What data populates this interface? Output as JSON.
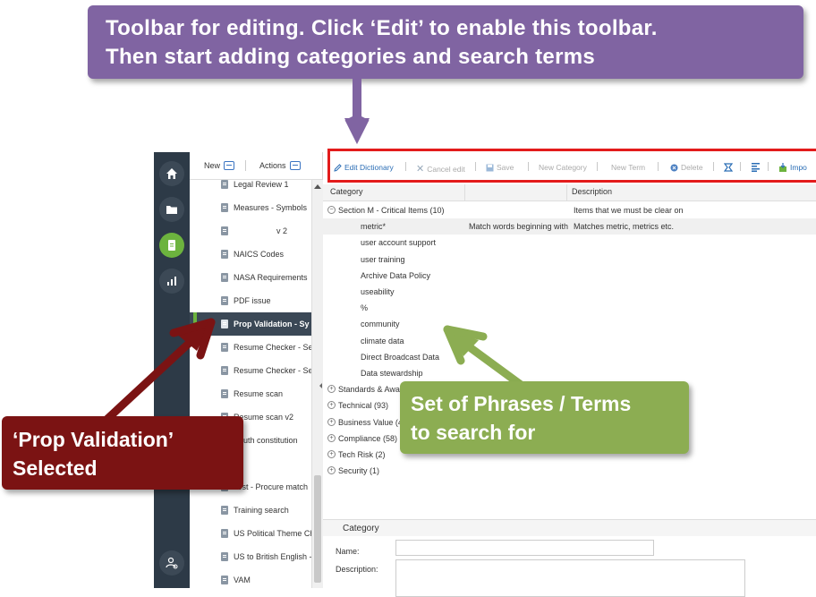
{
  "callouts": {
    "top": {
      "line1": "Toolbar for editing. Click ‘Edit’ to enable this toolbar.",
      "line2": "Then start adding categories and search terms"
    },
    "green": {
      "line1": "Set of Phrases / Terms",
      "line2": "to search for"
    },
    "red": {
      "line1": "‘Prop Validation’",
      "line2": "Selected"
    }
  },
  "colors": {
    "callout_purple": "#8064a2",
    "callout_green": "#8cad52",
    "callout_red": "#7b1313",
    "highlight_red": "#e31b1b",
    "nav_bg": "#2d3a47",
    "nav_active": "#6cb33e"
  },
  "nav": {
    "icons": [
      "home-icon",
      "folder-icon",
      "dictionary-icon",
      "chart-icon",
      "settings-user-icon"
    ]
  },
  "list_pane": {
    "new_label": "New",
    "actions_label": "Actions",
    "items": [
      {
        "label": "Legal Review 1"
      },
      {
        "label": "Measures - Symbols"
      },
      {
        "label": "v 2"
      },
      {
        "label": "NAICS Codes"
      },
      {
        "label": "NASA Requirements"
      },
      {
        "label": "PDF issue"
      },
      {
        "label": "Prop Validation - Sy",
        "selected": true
      },
      {
        "label": "Resume Checker - Sec"
      },
      {
        "label": "Resume Checker - Sec"
      },
      {
        "label": "Resume scan"
      },
      {
        "label": "Resume scan v2"
      },
      {
        "label": "South constitution"
      },
      {
        "label": ""
      },
      {
        "label": "Test - Procure match"
      },
      {
        "label": "Training search"
      },
      {
        "label": "US Political Theme Ch"
      },
      {
        "label": "US to British English -"
      },
      {
        "label": "VAM"
      }
    ]
  },
  "toolbar": {
    "edit_dictionary": "Edit Dictionary",
    "cancel_edit": "Cancel edit",
    "save": "Save",
    "new_category": "New Category",
    "new_term": "New Term",
    "delete": "Delete",
    "import": "Impo"
  },
  "grid": {
    "columns": [
      "Category",
      "Description"
    ],
    "rows": [
      {
        "kind": "group",
        "expanded": true,
        "label": "Section M - Critical Items (10)",
        "description": "Items that we must be clear on"
      },
      {
        "kind": "term",
        "label": "metric*",
        "match": "Match words beginning with",
        "description": "Matches metric, metrics etc.",
        "highlight": true
      },
      {
        "kind": "term",
        "label": "user account support"
      },
      {
        "kind": "term",
        "label": "user training"
      },
      {
        "kind": "term",
        "label": "Archive Data Policy"
      },
      {
        "kind": "term",
        "label": "useability"
      },
      {
        "kind": "term",
        "label": "%"
      },
      {
        "kind": "term",
        "label": "community"
      },
      {
        "kind": "term",
        "label": "climate data"
      },
      {
        "kind": "term",
        "label": "Direct Broadcast Data"
      },
      {
        "kind": "term",
        "label": "Data stewardship"
      },
      {
        "kind": "group",
        "label": "Standards & Awa"
      },
      {
        "kind": "group",
        "label": "Technical (93)"
      },
      {
        "kind": "group",
        "label": "Business Value (4"
      },
      {
        "kind": "group",
        "label": "Compliance (58)"
      },
      {
        "kind": "group",
        "label": "Tech Risk (2)"
      },
      {
        "kind": "group",
        "label": "Security (1)"
      }
    ]
  },
  "category_panel": {
    "title": "Category",
    "name_label": "Name:",
    "description_label": "Description:",
    "name_value": "",
    "description_value": ""
  }
}
